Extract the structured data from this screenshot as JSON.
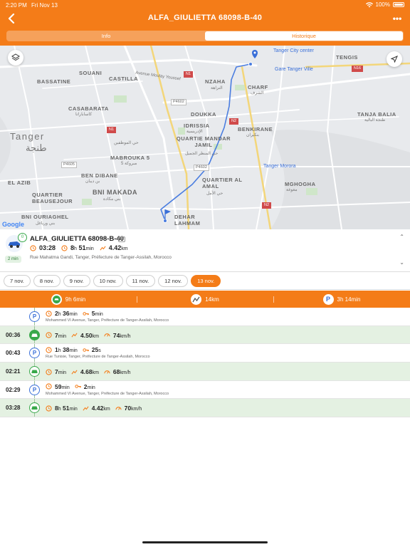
{
  "status_bar": {
    "time": "2:20 PM",
    "date": "Fri Nov 13",
    "battery": "100%"
  },
  "header": {
    "title": "ALFA_GIULIETTA 68098-B-40",
    "more": "•••",
    "tabs": [
      {
        "label": "Info"
      },
      {
        "label": "Historique"
      }
    ]
  },
  "map": {
    "labels": {
      "souani": "SOUANI",
      "castilla": "CASTILLA",
      "bassatine": "BASSATINE",
      "casabarata": "CASABARATA",
      "casabarata_ar": "كاساباراتا",
      "tanger": "Tanger",
      "tanger_ar": "طنجة",
      "mabrouka": "MABROUKA 5",
      "mabrouka_ar": "مبروكة 5",
      "el_mouhbine_ar": "حي الموظفين",
      "ben_dibane": "BEN DIBANE",
      "ben_dibane_ar": "بن ديبان",
      "el_azib": "EL AZIB",
      "quartier_beau": "QUARTIER\nBEAUSEJOUR",
      "bni_makada": "BNI MAKADA",
      "bni_makada_ar": "بني مكادة",
      "bni_ouriaghel": "BNI OURIAGHEL",
      "bni_ouriaghel_ar": "بني ورياغل",
      "dehar": "DEHAR\nLAHMAM",
      "nzaha": "NZAHA",
      "nzaha_ar": "النزاهة",
      "doukka": "DOUKKA",
      "idrissia": "IDRISSIA",
      "idrissia_ar": "الإدريسية",
      "quartie_mandar": "QUARTIE\nMANDAR JAMIL",
      "mandar_ar": "حي المنظر الجميل",
      "quartier_amal": "QUARTIER\nAL AMAL",
      "amal_ar": "حي الأمل",
      "charf": "CHARF",
      "charf_ar": "الشرف",
      "benkirane": "BENKIRANE",
      "benkirane_ar": "بنكيران",
      "tenges": "TENGIS",
      "tanja_balia": "TANJA BALIA",
      "tanja_balia_ar": "طنجة البالية",
      "mghogha": "MGHOGHA",
      "mghogha_ar": "مغوغة",
      "tanger_city_center": "Tanger City center",
      "gare": "Gare Tanger Ville",
      "tanger_morora": "Tanger Morora",
      "ave_moulay": "Avenue Moulay Youssef",
      "google": "Google",
      "road_n1": "N1",
      "road_p4602": "P4602",
      "road_p4605": "P4605",
      "road_n2": "N2",
      "road_n16": "N16",
      "road_a4": "A4"
    }
  },
  "vehicle": {
    "name": "ALFA_GIULIETTA 68098-B-40",
    "badge": "0",
    "tag": "8h",
    "start_time": "03:28",
    "duration_h": "8",
    "duration_m": "51",
    "distance": "4.42",
    "distance_unit": "km",
    "unit_h": "h",
    "unit_min": "min",
    "address": "Rue Mahatma Gandi, Tanger, Préfecture de Tanger-Assilah, Morocco",
    "elapsed": "2 min"
  },
  "dates": [
    "7 nov.",
    "8 nov.",
    "9 nov.",
    "10 nov.",
    "11 nov.",
    "12 nov.",
    "13 nov."
  ],
  "active_date_index": 6,
  "summary": {
    "drive": "9h 6min",
    "distance": "14km",
    "park": "3h 14min"
  },
  "timeline": [
    {
      "type": "park",
      "time": "",
      "a": "2",
      "au": "h",
      "b": "36",
      "bu": "min",
      "c": "5",
      "cu": "min",
      "address": "Mohammed VI Avenue, Tanger, Préfecture de Tanger-Assilah, Morocco"
    },
    {
      "type": "drive",
      "time": "00:36",
      "a": "7",
      "au": "min",
      "b": "4.50",
      "bu": "km",
      "c": "74",
      "cu": "km/h"
    },
    {
      "type": "park",
      "time": "00:43",
      "a": "1",
      "au": "h",
      "b": "38",
      "bu": "min",
      "c": "25",
      "cu": "s",
      "address": "Rue Tunisie, Tanger, Préfecture de Tanger-Assilah, Morocco"
    },
    {
      "type": "drive",
      "time": "02:21",
      "a": "7",
      "au": "min",
      "b": "4.68",
      "bu": "km",
      "c": "68",
      "cu": "km/h"
    },
    {
      "type": "park",
      "time": "02:29",
      "a": "59",
      "au": "min",
      "b": "",
      "bu": "",
      "c": "2",
      "cu": "min",
      "address": "Mohammed VI Avenue, Tanger, Préfecture de Tanger-Assilah, Morocco"
    },
    {
      "type": "drive",
      "time": "03:28",
      "a": "8",
      "au": "h",
      "b": "51",
      "bu": "min",
      "c": "4.42",
      "cu": "km",
      "d": "70",
      "du": "km/h"
    }
  ],
  "colors": {
    "accent": "#f47c18",
    "drive_bg": "#e4f1e2",
    "drive_green": "#38a84a",
    "park_blue": "#3a6fd8",
    "route_blue": "#4a7de0"
  },
  "icons": {
    "back": "chevron-left-icon",
    "layers": "layers-icon",
    "locate": "location-arrow-icon",
    "clock": "clock-icon",
    "key": "key-icon",
    "distance": "route-icon",
    "speed": "speedometer-icon",
    "car": "car-icon",
    "parking": "parking-icon"
  }
}
